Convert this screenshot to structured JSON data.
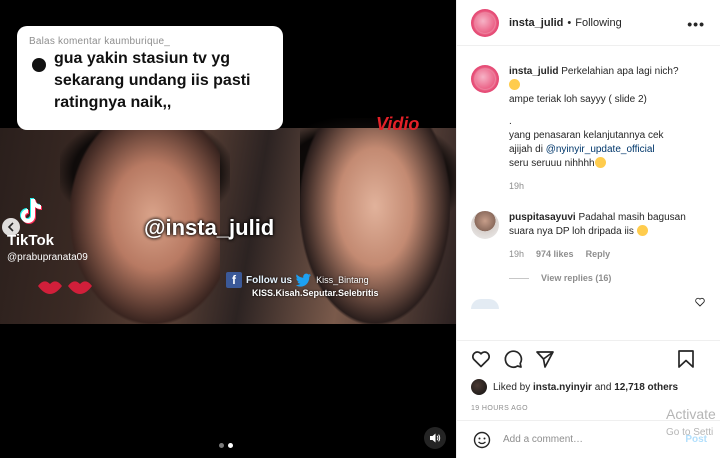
{
  "media": {
    "overlay_comment": {
      "header": "Balas komentar kaumburique_",
      "text": "gua yakin stasiun tv yg sekarang undang iis pasti ratingnya naik,,"
    },
    "broadcaster_logo": "Vidio",
    "tiktok": {
      "brand": "TikTok",
      "username": "@prabupranata09"
    },
    "watermark": "@insta_julid",
    "follow_bar": {
      "follow_us": "Follow us",
      "twitter_handle": "Kiss_Bintang",
      "subtitle": "KISS.Kisah.Seputar.Selebritis"
    },
    "carousel": {
      "slides": 2,
      "active_index": 1
    }
  },
  "header": {
    "username": "insta_julid",
    "separator": "•",
    "follow_status": "Following",
    "more_label": "•••"
  },
  "caption": {
    "username": "insta_julid",
    "line1": "Perkelahian apa lagi nich?",
    "line2": "ampe teriak loh sayyy ( slide 2)",
    "dot": ".",
    "line3": "yang penasaran kelanjutannya cek",
    "line4_prefix": "ajijah di",
    "mention": "@nyinyir_update_official",
    "line5": "seru seruuu nihhhh",
    "time": "19h"
  },
  "comments": [
    {
      "username": "puspitasayuvi",
      "text": "Padahal masih bagusan suara nya DP loh dripada iis",
      "time": "19h",
      "likes": "974 likes",
      "reply_label": "Reply",
      "view_replies": "View replies (16)"
    }
  ],
  "actions": {
    "liked_prefix": "Liked by",
    "liked_user": "insta.nyinyir",
    "liked_conj": "and",
    "liked_count": "12,718 others",
    "timestamp": "19 HOURS AGO"
  },
  "comment_box": {
    "placeholder": "Add a comment…",
    "post_label": "Post"
  },
  "os_overlay": {
    "title": "Activate",
    "subtitle": "Go to Setti"
  }
}
